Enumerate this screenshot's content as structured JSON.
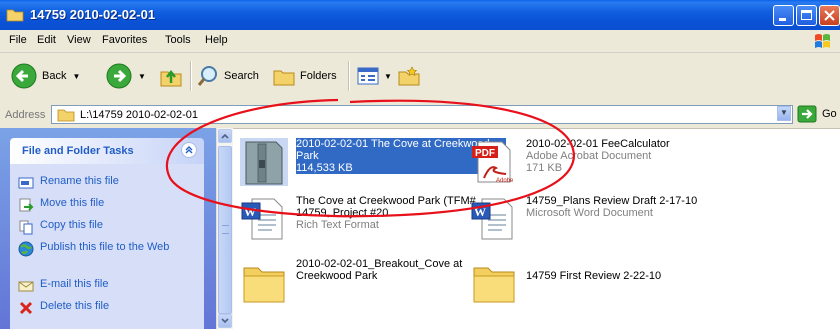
{
  "window": {
    "title": "14759 2010-02-02-01"
  },
  "menu": [
    "File",
    "Edit",
    "View",
    "Favorites",
    "Tools",
    "Help"
  ],
  "toolbar": {
    "back": "Back",
    "search": "Search",
    "folders": "Folders"
  },
  "address": {
    "label": "Address",
    "path": "L:\\14759 2010-02-02-01",
    "go": "Go"
  },
  "tasks": {
    "title": "File and Folder Tasks",
    "items": [
      {
        "label": "Rename this file"
      },
      {
        "label": "Move this file"
      },
      {
        "label": "Copy this file"
      },
      {
        "label": "Publish this file to the Web"
      },
      {
        "label": "E-mail this file"
      },
      {
        "label": "Delete this file"
      }
    ]
  },
  "files": [
    {
      "name": "2010-02-02-01 The Cove at Creekwood Park",
      "sub": "114,533 KB",
      "icon": "archive-file-icon",
      "selected": true
    },
    {
      "name": "2010-02-02-01 FeeCalculator",
      "sub": "Adobe Acrobat Document",
      "sub2": "171 KB",
      "icon": "pdf-file-icon"
    },
    {
      "name": "The Cove at Creekwood Park (TFM# 14759, Project #20...",
      "sub": "Rich Text Format",
      "icon": "rtf-file-icon"
    },
    {
      "name": "14759_Plans Review Draft 2-17-10",
      "sub": "Microsoft Word Document",
      "icon": "word-file-icon"
    },
    {
      "name": "2010-02-02-01_Breakout_Cove at Creekwood Park",
      "icon": "folder-icon"
    },
    {
      "name": "14759 First Review 2-22-10",
      "icon": "folder-icon"
    }
  ],
  "colors": {
    "titlebar": "#0a52d6",
    "selection": "#316ac5",
    "annotation": "#e8101a",
    "task_link": "#215dc6"
  }
}
